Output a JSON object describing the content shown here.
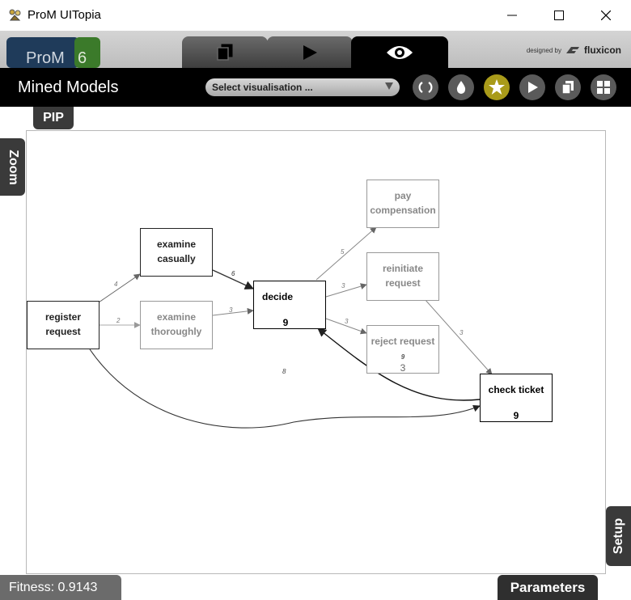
{
  "window": {
    "title": "ProM UITopia"
  },
  "header": {
    "logo": "ProM 6",
    "designed_by": "designed by",
    "brand": "fluxicon",
    "tabs": [
      "workspace",
      "actions",
      "views"
    ]
  },
  "toolbar": {
    "title": "Mined Models",
    "select_placeholder": "Select visualisation ...",
    "buttons": [
      "refresh",
      "color",
      "favorite",
      "play",
      "copy",
      "grid"
    ]
  },
  "side_tabs": {
    "pip": "PIP",
    "zoom": "Zoom",
    "setup": "Setup"
  },
  "graph": {
    "nodes": [
      {
        "id": "register",
        "label": "register\nrequest",
        "count": ""
      },
      {
        "id": "examine_casually",
        "label": "examine\ncasually",
        "count": ""
      },
      {
        "id": "examine_thoroughly",
        "label": "examine\nthoroughly",
        "count": ""
      },
      {
        "id": "decide",
        "label": "decide",
        "count": "9"
      },
      {
        "id": "pay",
        "label": "pay\ncompensation",
        "count": ""
      },
      {
        "id": "reinitiate",
        "label": "reinitiate\nrequest",
        "count": ""
      },
      {
        "id": "reject",
        "label": "reject request",
        "count": "3",
        "sub": "9"
      },
      {
        "id": "check_ticket",
        "label": "check ticket",
        "count": "9"
      }
    ],
    "edge_labels": {
      "reg_cas": "4",
      "reg_tho": "2",
      "cas_dec": "6",
      "tho_dec": "3",
      "dec_pay": "5",
      "dec_rei": "3",
      "dec_rej": "3",
      "rei_chk": "3",
      "chk_dec": "8"
    }
  },
  "footer": {
    "fitness": "Fitness: 0.9143",
    "parameters": "Parameters"
  },
  "colors": {
    "accent_gold": "#a99b1a",
    "logo_blue": "#1f3b5a",
    "logo_green": "#3b7a2a"
  }
}
